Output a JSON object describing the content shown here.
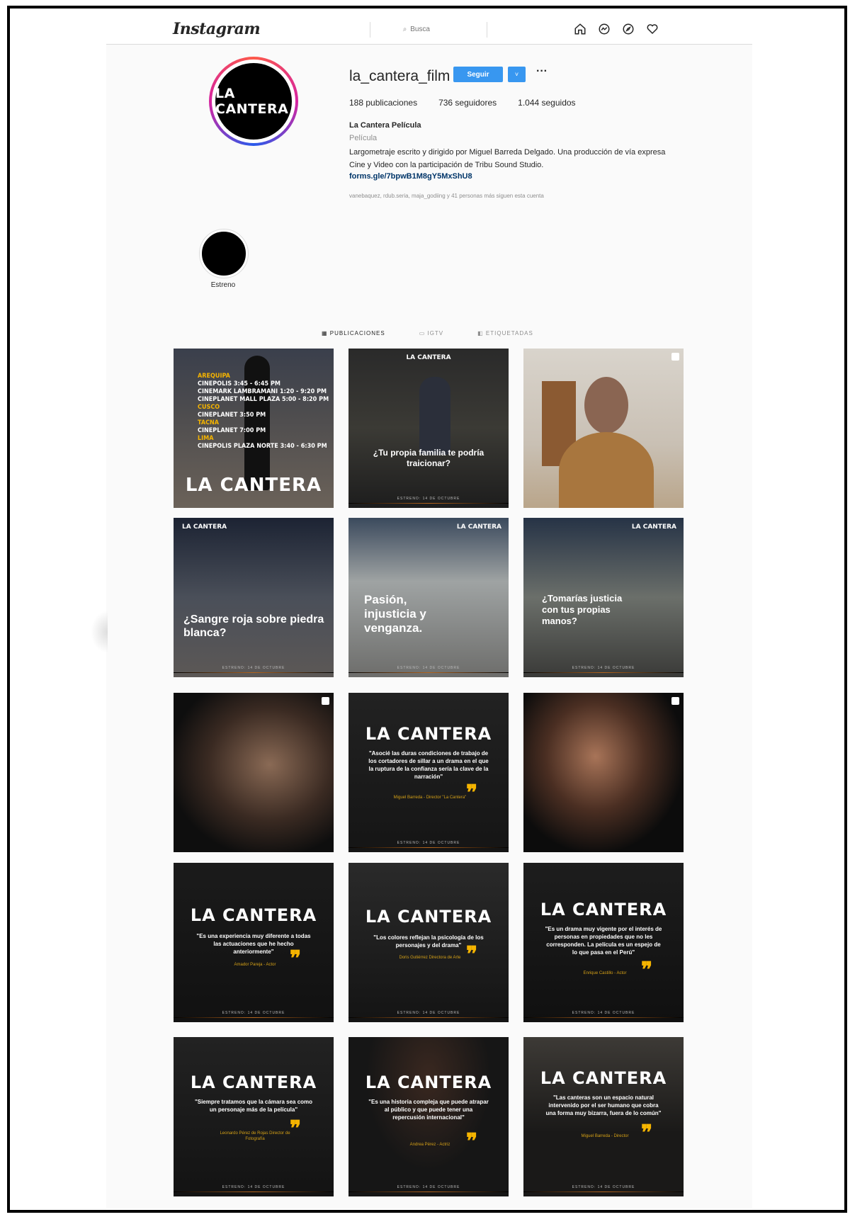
{
  "nav": {
    "logo": "Instagram",
    "search_placeholder": "Busca",
    "icons": [
      "home-icon",
      "messenger-icon",
      "explore-icon",
      "heart-icon"
    ]
  },
  "profile": {
    "avatar_text": "LA CANTERA",
    "username": "la_cantera_film",
    "follow_label": "Seguir",
    "dropdown_label": "˅",
    "more_label": "···",
    "stats": {
      "posts": "188 publicaciones",
      "followers": "736 seguidores",
      "following": "1.044 seguidos"
    },
    "full_name": "La Cantera Película",
    "category": "Película",
    "bio": "Largometraje escrito y dirigido por Miguel Barreda Delgado. Una producción de vía expresa Cine y Video con la participación de Tribu Sound Studio.",
    "link": "forms.gle/7bpwB1M8gY5MxShU8",
    "followed_by": "vanebaquez, rdub.seria, maja_godiing y 41 personas más siguen esta cuenta"
  },
  "highlight": {
    "label": "Estreno"
  },
  "tabs": [
    "PUBLICACIONES",
    "IGTV",
    "ETIQUETADAS"
  ],
  "brand": {
    "title": "LA CANTERA",
    "footer": "ESTRENO: 14 DE OCTUBRE"
  },
  "posts": {
    "p1": {
      "lines": [
        {
          "city": "AREQUIPA"
        },
        {
          "text": "CINEPOLIS 3:45 - 6:45 PM"
        },
        {
          "text": "CINEMARK LAMBRAMANI 1:20 - 9:20 PM"
        },
        {
          "text": "CINEPLANET MALL PLAZA 5:00 - 8:20 PM"
        },
        {
          "city": "CUSCO"
        },
        {
          "text": "CINEPLANET 3:50 PM"
        },
        {
          "city": "TACNA"
        },
        {
          "text": "CINEPLANET 7:00 PM"
        },
        {
          "city": "LIMA"
        },
        {
          "text": "CINEPOLIS PLAZA NORTE 3:40 - 6:30 PM"
        }
      ]
    },
    "p2": {
      "tagline": "¿Tu propia familia te podría traicionar?"
    },
    "p4": {
      "tagline": "¿Sangre roja sobre piedra blanca?"
    },
    "p5": {
      "tagline": "Pasión, injusticia y venganza."
    },
    "p6": {
      "tagline": "¿Tomarías justicia con tus propias manos?"
    },
    "p8": {
      "quote": "\"Asocié las duras condiciones de trabajo de los cortadores de sillar a un drama en el que la ruptura de la confianza sería la clave de la narración\"",
      "credit": "Miguel Barreda - Director \"La Cantera\""
    },
    "p10": {
      "quote": "\"Es una experiencia muy diferente a todas las actuaciones que he hecho anteriormente\"",
      "credit": "Amador Pareja - Actor"
    },
    "p11": {
      "quote": "\"Los colores reflejan la psicología de los personajes y del drama\"",
      "credit": "Doris Gutiérrez Directora de Arte"
    },
    "p12": {
      "quote": "\"Es un drama muy vigente por el interés de personas en propiedades que no les corresponden. La película es un espejo de lo que pasa en el Perú\"",
      "credit": "Enrique Castillo - Actor"
    },
    "p13": {
      "quote": "\"Siempre tratamos que la cámara sea como un personaje más de la película\"",
      "credit": "Leonardo Pérez de Rojas Director de Fotografía"
    },
    "p14": {
      "quote": "\"Es una historia compleja que puede atrapar al público y que puede tener una repercusión internacional\"",
      "credit": "Andrea Pérez - Actriz"
    },
    "p15": {
      "quote": "\"Las canteras son un espacio natural intervenido por el ser humano que cobra una forma muy bizarra, fuera de lo común\"",
      "credit": "Miguel Barreda - Director"
    }
  },
  "colors": {
    "follow_blue": "#3897f0",
    "accent_gold": "#f5b400"
  }
}
